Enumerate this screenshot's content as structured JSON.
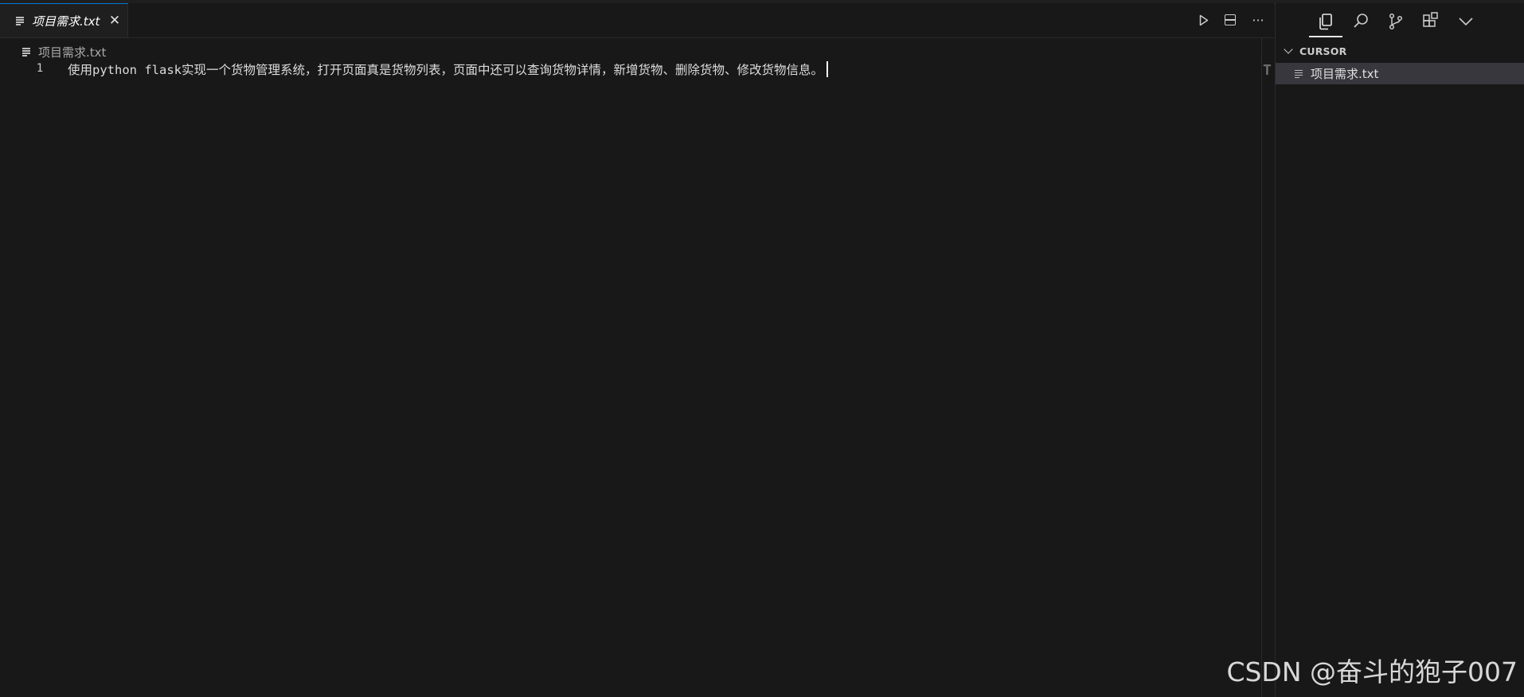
{
  "tab": {
    "label": "项目需求.txt",
    "close_glyph": "✕"
  },
  "editor_actions": {
    "more_glyph": "···"
  },
  "breadcrumb": {
    "label": "项目需求.txt"
  },
  "document": {
    "line_number": "1",
    "line_text": "使用python flask实现一个货物管理系统，打开页面真是货物列表，页面中还可以查询货物详情，新增货物、删除货物、修改货物信息。"
  },
  "minimap": {
    "marker": "T"
  },
  "sidebar": {
    "section_title": "CURSOR",
    "files": [
      {
        "label": "项目需求.txt"
      }
    ]
  },
  "watermark": "CSDN @奋斗的狍子007",
  "colors": {
    "background": "#181818",
    "active_tab_border": "#0078d4",
    "selected_row": "#37373d"
  },
  "icons": [
    "file-lines-icon",
    "close-icon",
    "run-icon",
    "split-editor-icon",
    "more-actions-icon",
    "explorer-copy-icon",
    "search-icon",
    "source-control-icon",
    "extensions-icon",
    "chevron-down-icon"
  ]
}
